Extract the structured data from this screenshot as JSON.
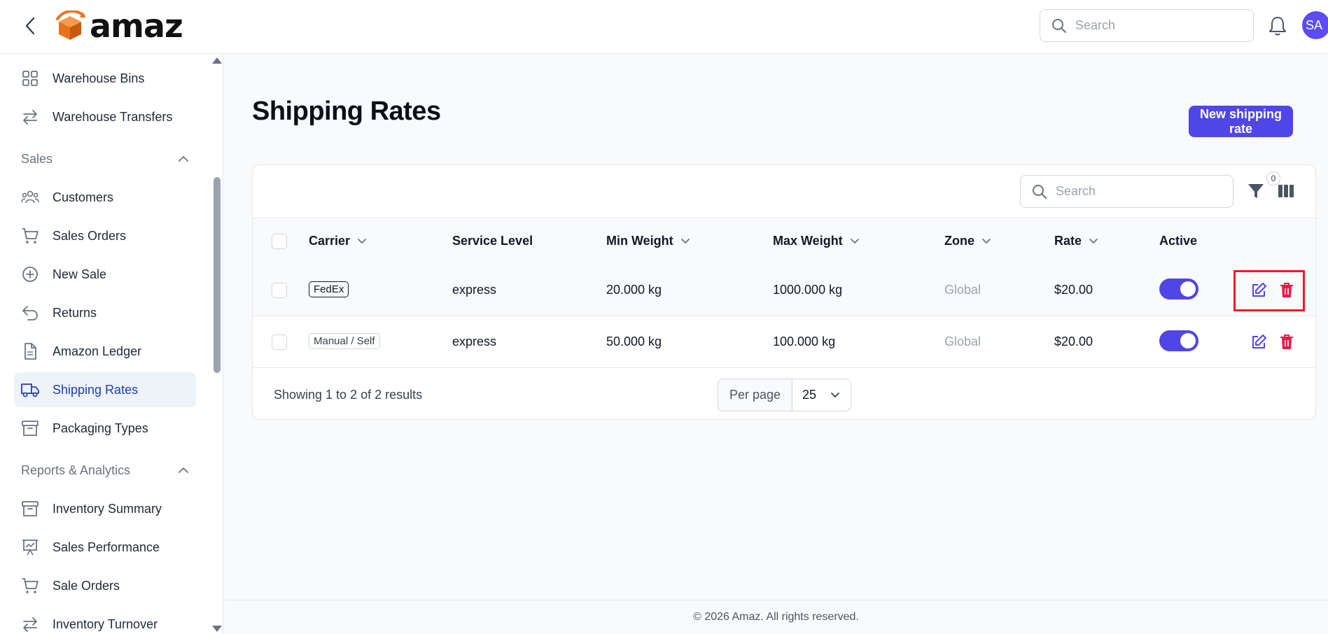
{
  "header": {
    "logo_text": "amaz",
    "search_placeholder": "Search",
    "avatar_initials": "SA"
  },
  "sidebar": {
    "items_top": [
      {
        "label": "Warehouse Bins",
        "icon": "grid-icon"
      },
      {
        "label": "Warehouse Transfers",
        "icon": "arrows-left-right-icon"
      }
    ],
    "sales_section": "Sales",
    "sales_items": [
      {
        "label": "Customers",
        "icon": "users-icon"
      },
      {
        "label": "Sales Orders",
        "icon": "cart-icon"
      },
      {
        "label": "New Sale",
        "icon": "plus-circle-icon"
      },
      {
        "label": "Returns",
        "icon": "undo-arrow-icon"
      },
      {
        "label": "Amazon Ledger",
        "icon": "document-icon"
      },
      {
        "label": "Shipping Rates",
        "icon": "truck-icon"
      },
      {
        "label": "Packaging Types",
        "icon": "archive-box-icon"
      }
    ],
    "reports_section": "Reports & Analytics",
    "reports_items": [
      {
        "label": "Inventory Summary",
        "icon": "archive-box-icon"
      },
      {
        "label": "Sales Performance",
        "icon": "presentation-chart-icon"
      },
      {
        "label": "Sale Orders",
        "icon": "cart-icon"
      },
      {
        "label": "Inventory Turnover",
        "icon": "arrows-left-right-icon"
      }
    ]
  },
  "main": {
    "title": "Shipping Rates",
    "new_button": "New shipping rate",
    "table_search_placeholder": "Search",
    "filter_count": "0",
    "columns": [
      "Carrier",
      "Service Level",
      "Min Weight",
      "Max Weight",
      "Zone",
      "Rate",
      "Active"
    ],
    "rows": [
      {
        "carrier": "FedEx",
        "service_level": "express",
        "min_weight": "20.000 kg",
        "max_weight": "1000.000 kg",
        "zone": "Global",
        "rate": "$20.00",
        "active": true
      },
      {
        "carrier": "Manual / Self",
        "service_level": "express",
        "min_weight": "50.000 kg",
        "max_weight": "100.000 kg",
        "zone": "Global",
        "rate": "$20.00",
        "active": true
      }
    ],
    "showing_text": "Showing 1 to 2 of 2 results",
    "per_page_label": "Per page",
    "per_page_value": "25"
  },
  "footer": {
    "text": "© 2026 Amaz. All rights reserved."
  },
  "colors": {
    "accent": "#4f46e5",
    "danger": "#e11d48",
    "highlight": "#ef1c24"
  }
}
